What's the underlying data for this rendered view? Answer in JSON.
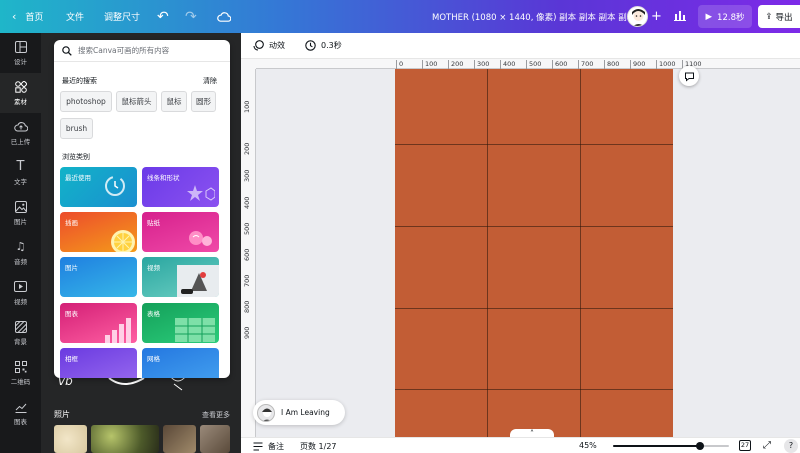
{
  "topbar": {
    "home": "首页",
    "file": "文件",
    "resize": "调整尺寸",
    "title": "MOTHER (1080 × 1440, 像素) 副本 副本 副本 副本",
    "play_label": "12.8秒",
    "export_label": "导出",
    "colors": {
      "gradient_start": "#1fb6c9",
      "gradient_end": "#7d2ae8"
    }
  },
  "rail": {
    "items": [
      {
        "label": "设计",
        "icon": "layout-icon"
      },
      {
        "label": "素材",
        "icon": "elements-icon",
        "active": true
      },
      {
        "label": "已上传",
        "icon": "upload-icon"
      },
      {
        "label": "文字",
        "icon": "text-icon"
      },
      {
        "label": "图片",
        "icon": "image-icon"
      },
      {
        "label": "音频",
        "icon": "music-icon"
      },
      {
        "label": "视频",
        "icon": "video-icon"
      },
      {
        "label": "背景",
        "icon": "background-icon"
      },
      {
        "label": "二维码",
        "icon": "qr-icon"
      },
      {
        "label": "图表",
        "icon": "chart-icon"
      }
    ]
  },
  "search": {
    "placeholder": "搜索Canva可画的所有内容",
    "recent_title": "最近的搜索",
    "clear_label": "清除",
    "recent": [
      "photoshop",
      "鼠标箭头",
      "鼠标",
      "圆形",
      "brush"
    ],
    "browse_title": "浏览类别",
    "categories": [
      {
        "label": "最近使用"
      },
      {
        "label": "线条和形状"
      },
      {
        "label": "插画"
      },
      {
        "label": "贴纸"
      },
      {
        "label": "图片"
      },
      {
        "label": "视频"
      },
      {
        "label": "图表"
      },
      {
        "label": "表格"
      },
      {
        "label": "相框"
      },
      {
        "label": "网格"
      }
    ]
  },
  "photos": {
    "title": "照片",
    "more": "查看更多"
  },
  "editor": {
    "animate_label": "动效",
    "duration_label": "0.3秒",
    "ruler_top": [
      "0",
      "100",
      "200",
      "300",
      "400",
      "500",
      "600",
      "700",
      "800",
      "900",
      "1000",
      "1100"
    ],
    "ruler_left": [
      "100",
      "200",
      "300",
      "400",
      "500",
      "600",
      "700",
      "800",
      "900"
    ],
    "canvas_color": "#c25d35"
  },
  "music": {
    "label": "I Am Leaving"
  },
  "bottombar": {
    "notes_label": "备注",
    "pages_label": "页数 1/27",
    "zoom_label": "45%",
    "zoom_level": 0.45,
    "page_count": "27"
  }
}
